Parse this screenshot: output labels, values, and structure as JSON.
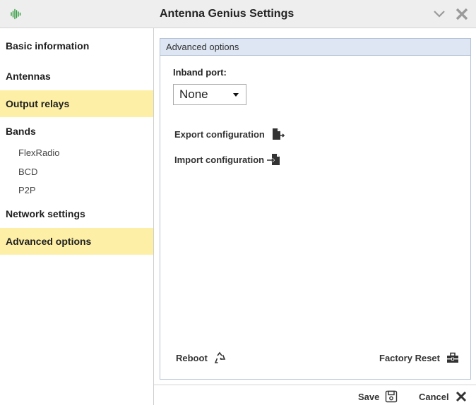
{
  "window": {
    "title": "Antenna Genius Settings",
    "app_icon": "antenna-waveform-icon",
    "collapse_icon": "chevron-down-icon",
    "close_icon": "close-icon",
    "accent": "#2f9a3a"
  },
  "sidebar": {
    "items": [
      {
        "label": "Basic information",
        "active": false
      },
      {
        "label": "Antennas",
        "active": false
      },
      {
        "label": "Output relays",
        "active": true
      },
      {
        "label": "Bands",
        "active": false
      },
      {
        "label": "Network settings",
        "active": false
      },
      {
        "label": "Advanced options",
        "active": true
      }
    ],
    "band_subitems": [
      "FlexRadio",
      "BCD",
      "P2P"
    ],
    "highlight_color": "#fdefa6"
  },
  "panel": {
    "header": "Advanced options",
    "inband_port_label": "Inband port:",
    "inband_port_value": "None",
    "export_label": "Export configuration",
    "import_label": "Import configuration",
    "reboot_label": "Reboot",
    "factory_reset_label": "Factory Reset"
  },
  "footer": {
    "save_label": "Save",
    "cancel_label": "Cancel"
  }
}
